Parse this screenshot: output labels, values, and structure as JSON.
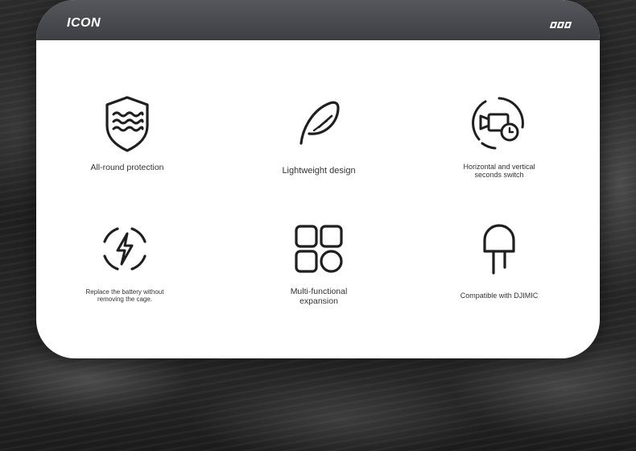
{
  "header": {
    "title": "ICON",
    "indicator_count": 3
  },
  "colors": {
    "header_bg": "#47484e",
    "card_bg": "#ffffff",
    "icon_stroke": "#1f1f1f",
    "label_text": "#333333"
  },
  "features": [
    {
      "icon": "shield-waves-icon",
      "label": "All-round protection"
    },
    {
      "icon": "feather-icon",
      "label": "Lightweight design"
    },
    {
      "icon": "camera-rotate-icon",
      "label_lines": [
        "Horizontal and vertical",
        "seconds switch"
      ]
    },
    {
      "icon": "battery-bolt-icon",
      "label_lines": [
        "Replace the battery without",
        "removing the cage."
      ]
    },
    {
      "icon": "grid-apps-icon",
      "label_lines": [
        "Multi-functional",
        "expansion"
      ]
    },
    {
      "icon": "microphone-plug-icon",
      "label": "Compatible with DJIMIC"
    }
  ]
}
